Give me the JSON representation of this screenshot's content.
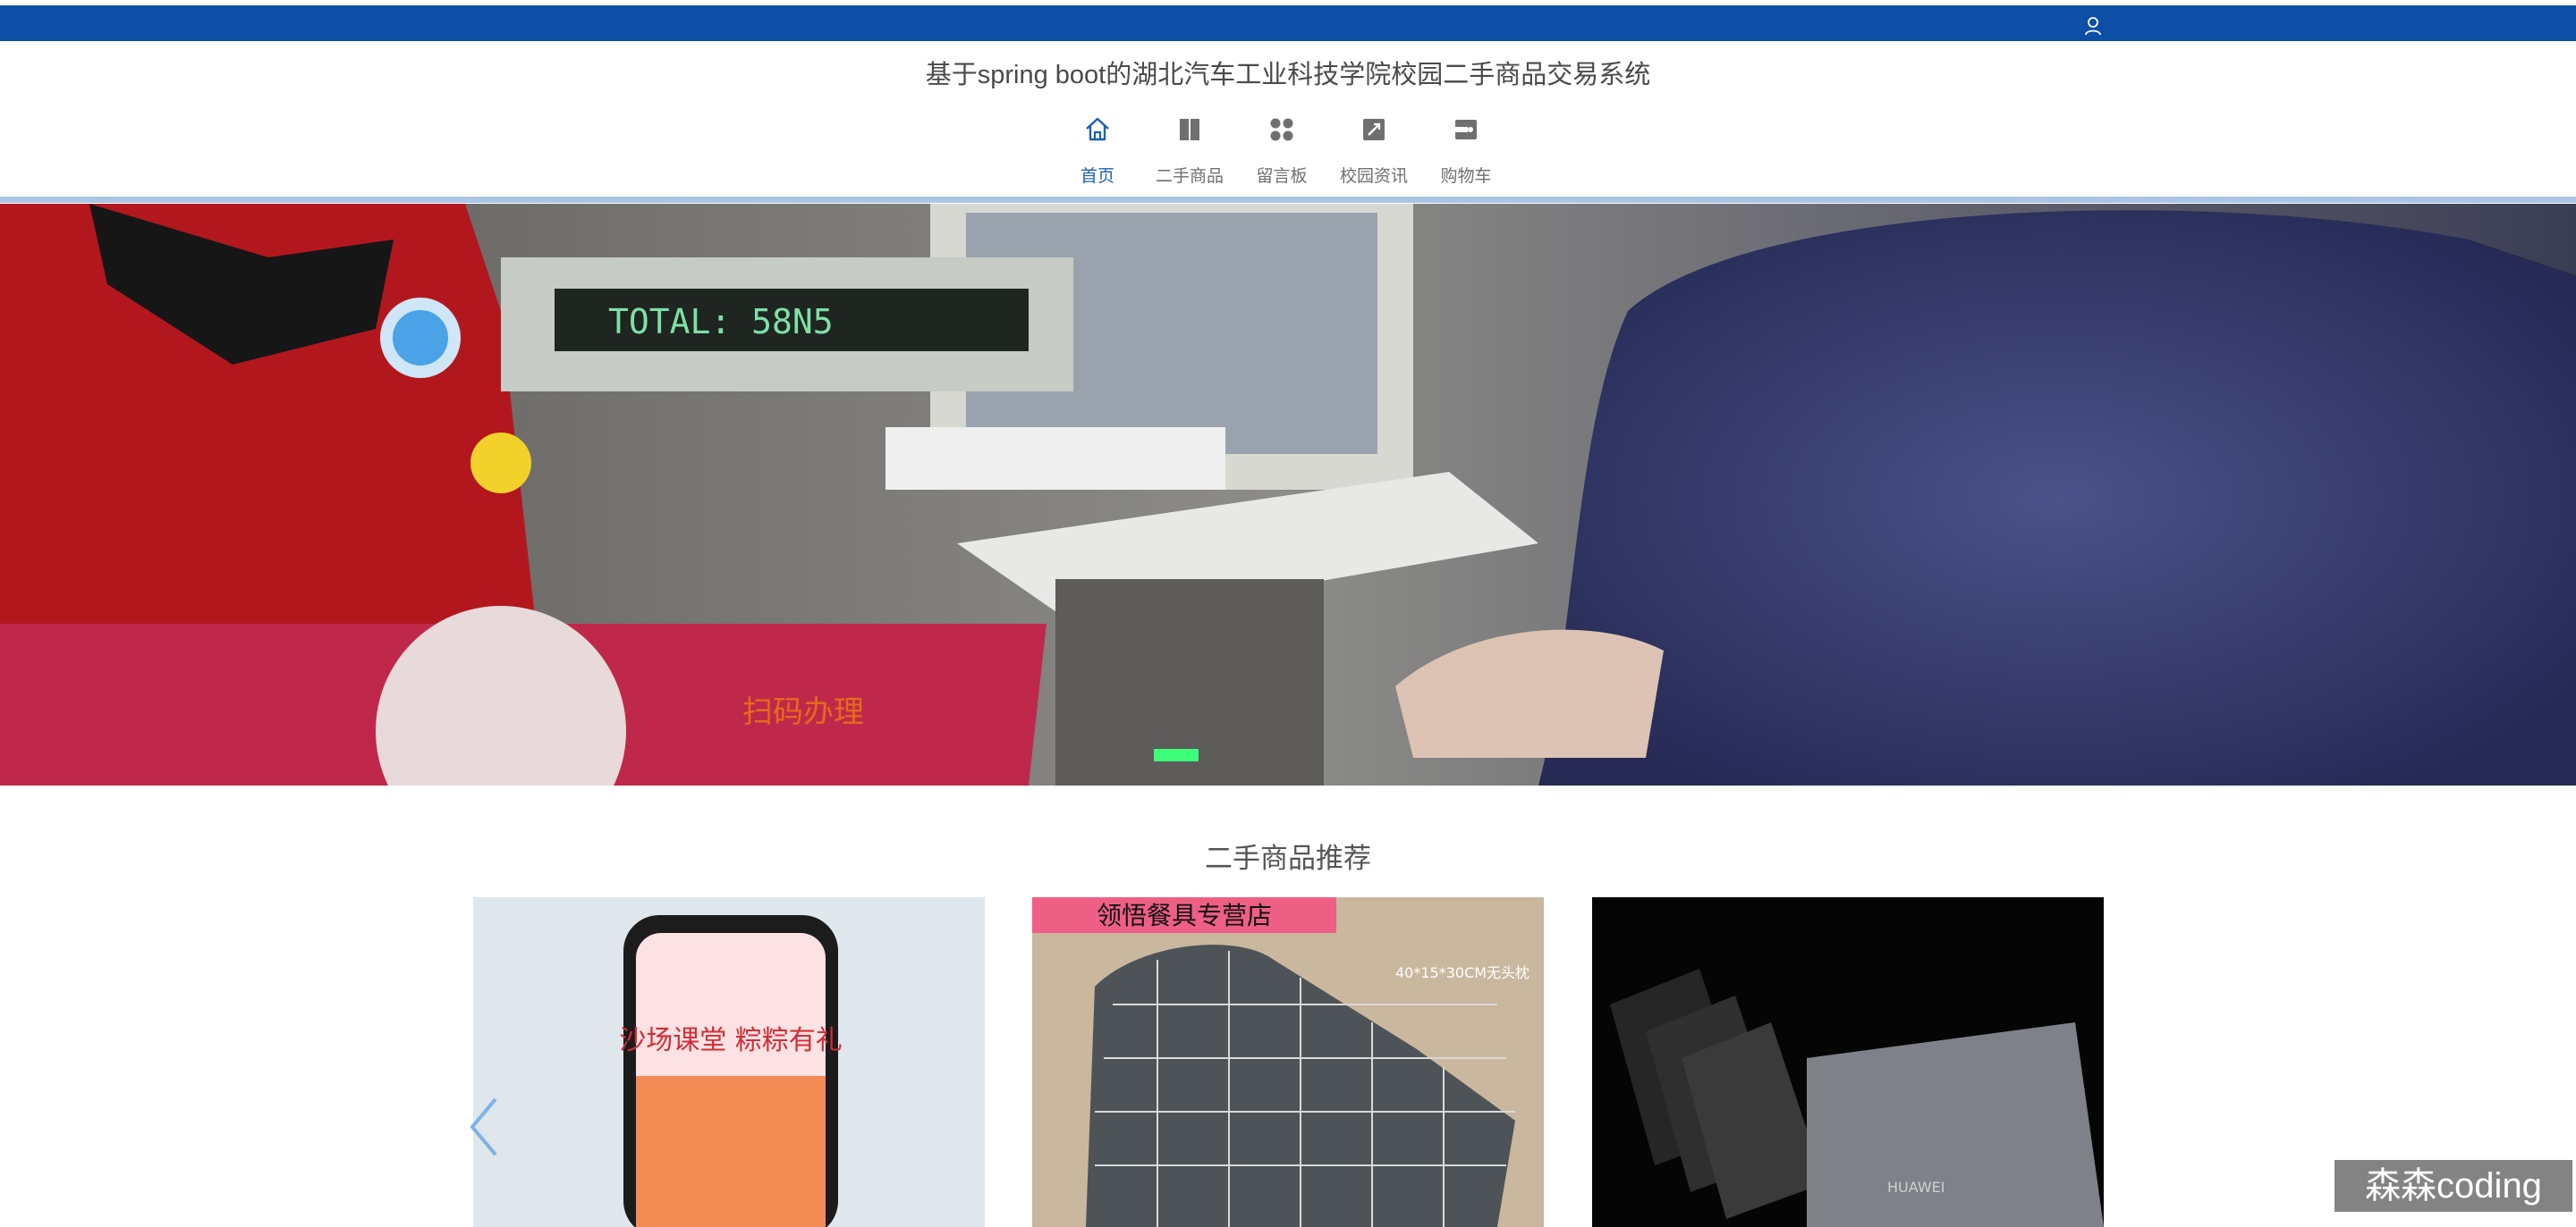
{
  "header": {
    "site_title": "基于spring boot的湖北汽车工业科技学院校园二手商品交易系统",
    "user_icon": "user-icon"
  },
  "nav": {
    "items": [
      {
        "label": "首页",
        "icon": "home-icon",
        "active": true
      },
      {
        "label": "二手商品",
        "icon": "book-icon",
        "active": false
      },
      {
        "label": "留言板",
        "icon": "grid-icon",
        "active": false
      },
      {
        "label": "校园资讯",
        "icon": "news-icon",
        "active": false
      },
      {
        "label": "购物车",
        "icon": "cart-icon",
        "active": false
      }
    ]
  },
  "banner": {
    "display_text": "TOTAL: 58N5",
    "sign_text": "扫码办理"
  },
  "recommend": {
    "title": "二手商品推荐",
    "products": [
      {
        "image_text": "沙场课堂 粽粽有礼"
      },
      {
        "image_text": "领悟餐具专营店",
        "size_tag": "40*15*30CM无头枕"
      },
      {
        "image_text": "HUAWEI"
      }
    ]
  },
  "watermark": "森森coding",
  "colors": {
    "topbar": "#0d4ea6",
    "nav_active": "#1d5fb8",
    "nav_separator": "#a9c6e6"
  }
}
